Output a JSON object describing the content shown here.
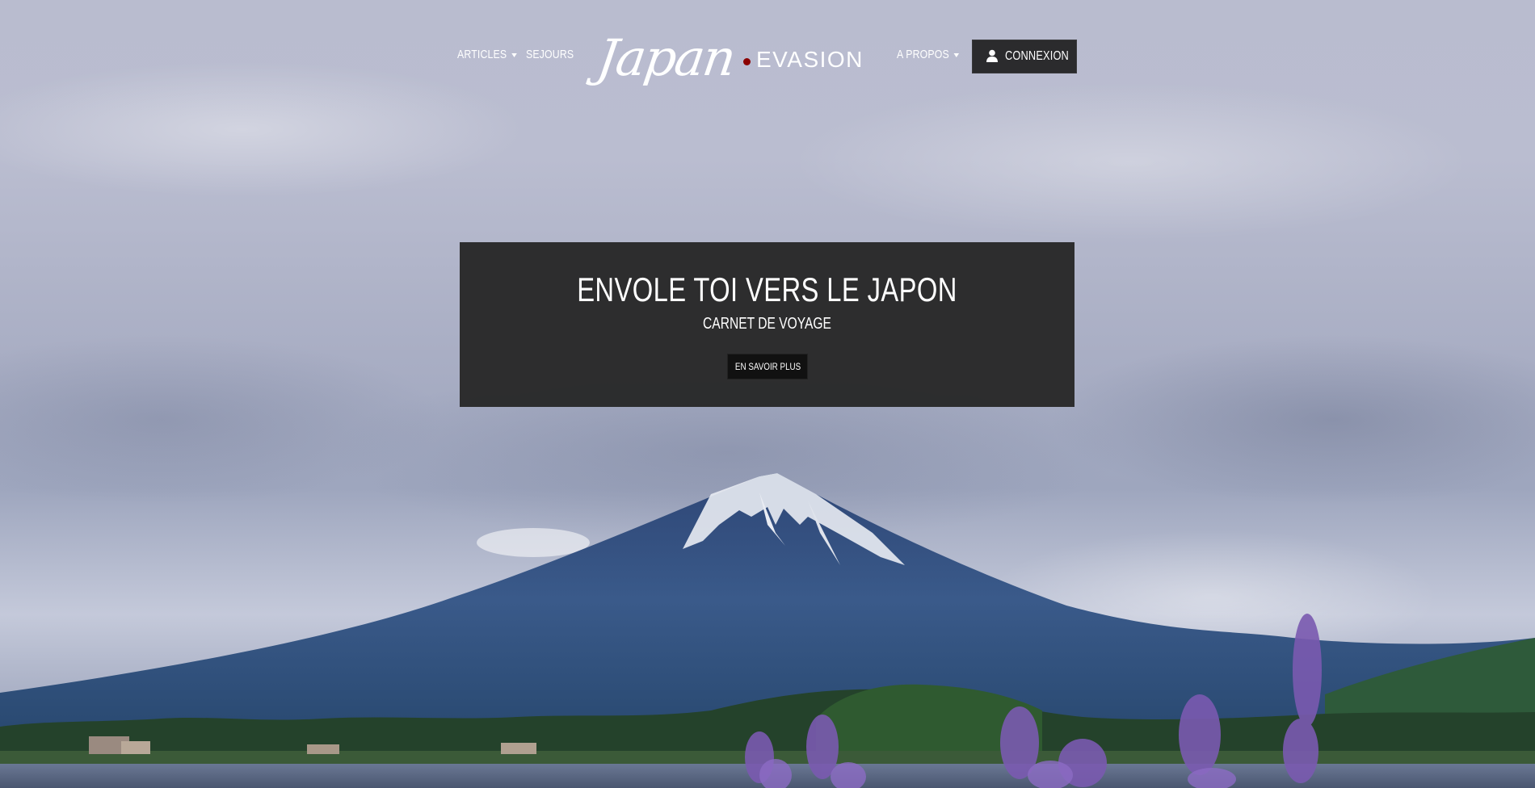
{
  "nav": {
    "articles_label": "ARTICLES",
    "sejours_label": "SEJOURS",
    "apropos_label": "A PROPOS",
    "login_label": "CONNEXION",
    "login_icon": "user-icon",
    "dropdown_icon": "caret-down-icon"
  },
  "logo": {
    "script": "Japan",
    "word": "EVASION",
    "dot_color": "#8b0000"
  },
  "banner": {
    "title": "ENVOLE TOI VERS LE JAPON",
    "subtitle": "CARNET DE VOYAGE",
    "button_label": "EN SAVOIR PLUS"
  },
  "colors": {
    "banner_bg": "#282828",
    "button_bg": "#111111",
    "login_bg": "#2b2b2d"
  }
}
